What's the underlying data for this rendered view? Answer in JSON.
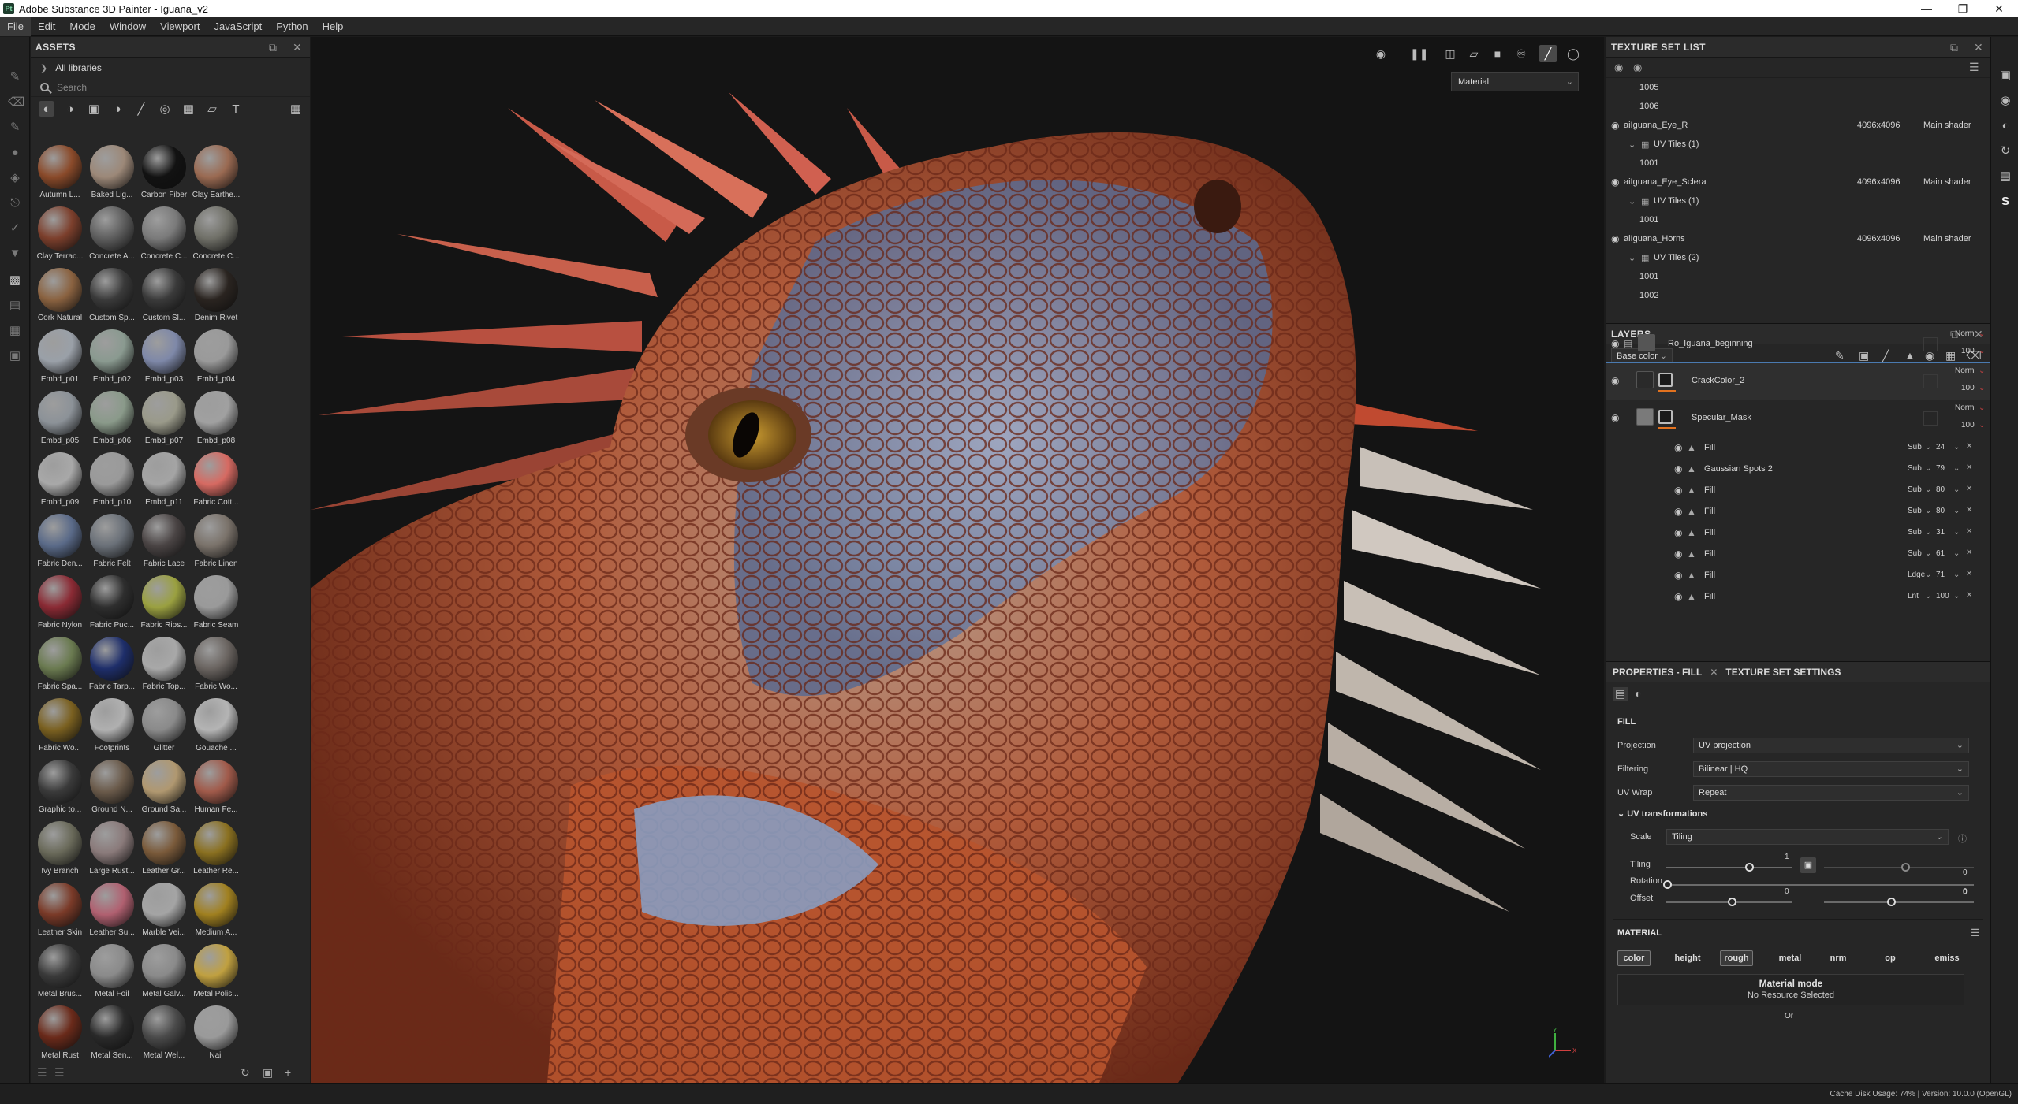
{
  "window": {
    "title": "Adobe Substance 3D Painter - Iguana_v2",
    "logo": "Pt"
  },
  "menu": [
    "File",
    "Edit",
    "Mode",
    "Window",
    "Viewport",
    "JavaScript",
    "Python",
    "Help"
  ],
  "assets": {
    "title": "ASSETS",
    "library": "All libraries",
    "search_placeholder": "Search",
    "items": [
      {
        "label": "Autumn L...",
        "color": "#8a4a2a"
      },
      {
        "label": "Baked Lig...",
        "color": "#9c8878"
      },
      {
        "label": "Carbon Fiber",
        "color": "#121212"
      },
      {
        "label": "Clay Earthe...",
        "color": "#9a6a52"
      },
      {
        "label": "Clay Terrac...",
        "color": "#7c3f2c"
      },
      {
        "label": "Concrete A...",
        "color": "#5e5e5e"
      },
      {
        "label": "Concrete C...",
        "color": "#7a7a7a"
      },
      {
        "label": "Concrete C...",
        "color": "#707068"
      },
      {
        "label": "Cork Natural",
        "color": "#8a6240"
      },
      {
        "label": "Custom Sp...",
        "color": "#3a3a3a"
      },
      {
        "label": "Custom Sl...",
        "color": "#3a3a3a"
      },
      {
        "label": "Denim Rivet",
        "color": "#2a2420"
      },
      {
        "label": "Embd_p01",
        "color": "#9aa0a8"
      },
      {
        "label": "Embd_p02",
        "color": "#8a9a90"
      },
      {
        "label": "Embd_p03",
        "color": "#7e88a8"
      },
      {
        "label": "Embd_p04",
        "color": "#9a9a9a"
      },
      {
        "label": "Embd_p05",
        "color": "#8c9298"
      },
      {
        "label": "Embd_p06",
        "color": "#8a9a8a"
      },
      {
        "label": "Embd_p07",
        "color": "#9a9a8a"
      },
      {
        "label": "Embd_p08",
        "color": "#a0a0a0"
      },
      {
        "label": "Embd_p09",
        "color": "#a8a8a8"
      },
      {
        "label": "Embd_p10",
        "color": "#9a9a9a"
      },
      {
        "label": "Embd_p11",
        "color": "#a4a4a4"
      },
      {
        "label": "Fabric Cott...",
        "color": "#d66a62"
      },
      {
        "label": "Fabric Den...",
        "color": "#5a6a88"
      },
      {
        "label": "Fabric Felt",
        "color": "#6a7078"
      },
      {
        "label": "Fabric Lace",
        "color": "#4a4444"
      },
      {
        "label": "Fabric Linen",
        "color": "#7a726a"
      },
      {
        "label": "Fabric Nylon",
        "color": "#8a2a34"
      },
      {
        "label": "Fabric Puc...",
        "color": "#2e2e2e"
      },
      {
        "label": "Fabric Rips...",
        "color": "#9aa040"
      },
      {
        "label": "Fabric Seam",
        "color": "#9a9a9a"
      },
      {
        "label": "Fabric Spa...",
        "color": "#6a7a50"
      },
      {
        "label": "Fabric Tarp...",
        "color": "#1e2e6a"
      },
      {
        "label": "Fabric Top...",
        "color": "#a8a8a8"
      },
      {
        "label": "Fabric Wo...",
        "color": "#6a6460"
      },
      {
        "label": "Fabric Wo...",
        "color": "#7a6020"
      },
      {
        "label": "Footprints",
        "color": "#b0b0b0"
      },
      {
        "label": "Glitter",
        "color": "#8a8a8a"
      },
      {
        "label": "Gouache ...",
        "color": "#b4b4b4"
      },
      {
        "label": "Graphic to...",
        "color": "#3a3a3a"
      },
      {
        "label": "Ground N...",
        "color": "#6a5a4a"
      },
      {
        "label": "Ground Sa...",
        "color": "#b09870"
      },
      {
        "label": "Human Fe...",
        "color": "#a05a4a"
      },
      {
        "label": "Ivy Branch",
        "color": "#6a6a5a"
      },
      {
        "label": "Large Rust...",
        "color": "#8a7a7a"
      },
      {
        "label": "Leather Gr...",
        "color": "#7a5a3a"
      },
      {
        "label": "Leather Re...",
        "color": "#8a7020"
      },
      {
        "label": "Leather Skin",
        "color": "#7a3a28"
      },
      {
        "label": "Leather Su...",
        "color": "#b06070"
      },
      {
        "label": "Marble Vei...",
        "color": "#a4a4a4"
      },
      {
        "label": "Medium A...",
        "color": "#a08020"
      },
      {
        "label": "Metal Brus...",
        "color": "#3a3a3a"
      },
      {
        "label": "Metal Foil",
        "color": "#8a8a8a"
      },
      {
        "label": "Metal Galv...",
        "color": "#8a8a8a"
      },
      {
        "label": "Metal Polis...",
        "color": "#c0a040"
      },
      {
        "label": "Metal Rust",
        "color": "#6a2a1a"
      },
      {
        "label": "Metal Sen...",
        "color": "#2a2a2a"
      },
      {
        "label": "Metal Wel...",
        "color": "#4a4a4a"
      },
      {
        "label": "Nail",
        "color": "#9a9a9a"
      }
    ]
  },
  "viewport": {
    "mode": "Material",
    "axis_x": "X",
    "axis_y": "Y",
    "axis_z": "Z"
  },
  "texture_set_list": {
    "title": "TEXTURE SET LIST",
    "rows": [
      {
        "kind": "tile",
        "text": "1005"
      },
      {
        "kind": "tile",
        "text": "1006"
      },
      {
        "kind": "set",
        "name": "aiIguana_Eye_R",
        "res": "4096x4096",
        "shader": "Main shader"
      },
      {
        "kind": "uv",
        "text": "UV Tiles (1)"
      },
      {
        "kind": "tile",
        "text": "1001"
      },
      {
        "kind": "set",
        "name": "aiIguana_Eye_Sclera",
        "res": "4096x4096",
        "shader": "Main shader"
      },
      {
        "kind": "uv",
        "text": "UV Tiles (1)"
      },
      {
        "kind": "tile",
        "text": "1001"
      },
      {
        "kind": "set",
        "name": "aiIguana_Horns",
        "res": "4096x4096",
        "shader": "Main shader"
      },
      {
        "kind": "uv",
        "text": "UV Tiles (2)"
      },
      {
        "kind": "tile",
        "text": "1001"
      },
      {
        "kind": "tile",
        "text": "1002"
      }
    ]
  },
  "layers": {
    "title": "LAYERS",
    "channel": "Base color",
    "main": [
      {
        "name": "Ro_Iguana_beginning",
        "blend": "Norm",
        "opacity": "100"
      },
      {
        "name": "CrackColor_2",
        "blend": "Norm",
        "opacity": "100"
      },
      {
        "name": "Specular_Mask",
        "blend": "Norm",
        "opacity": "100"
      }
    ],
    "effects": [
      {
        "name": "Fill",
        "blend": "Sub",
        "value": "24"
      },
      {
        "name": "Gaussian Spots 2",
        "blend": "Sub",
        "value": "79"
      },
      {
        "name": "Fill",
        "blend": "Sub",
        "value": "80"
      },
      {
        "name": "Fill",
        "blend": "Sub",
        "value": "80"
      },
      {
        "name": "Fill",
        "blend": "Sub",
        "value": "31"
      },
      {
        "name": "Fill",
        "blend": "Sub",
        "value": "61"
      },
      {
        "name": "Fill",
        "blend": "Ldge",
        "value": "71"
      },
      {
        "name": "Fill",
        "blend": "Lnt",
        "value": "100"
      }
    ]
  },
  "properties": {
    "tab1": "PROPERTIES - FILL",
    "tab2": "TEXTURE SET SETTINGS",
    "section": "FILL",
    "projection_label": "Projection",
    "projection": "UV projection",
    "filtering_label": "Filtering",
    "filtering": "Bilinear | HQ",
    "uvwrap_label": "UV Wrap",
    "uvwrap": "Repeat",
    "uvtrans": "UV transformations",
    "scale_label": "Scale",
    "scale": "Tiling",
    "tiling_label": "Tiling",
    "tiling_value": "1",
    "tiling_value2": "0",
    "rotation_label": "Rotation",
    "rotation_value": "0",
    "offset_label": "Offset",
    "offset_value": "0",
    "offset_value2": "0",
    "material_title": "MATERIAL",
    "channels": [
      "color",
      "height",
      "rough",
      "metal",
      "nrm",
      "op",
      "emiss"
    ],
    "material_mode": "Material mode",
    "no_resource": "No Resource Selected",
    "or": "Or"
  },
  "status": {
    "text": "Cache Disk Usage:   74% | Version: 10.0.0 (OpenGL)"
  }
}
